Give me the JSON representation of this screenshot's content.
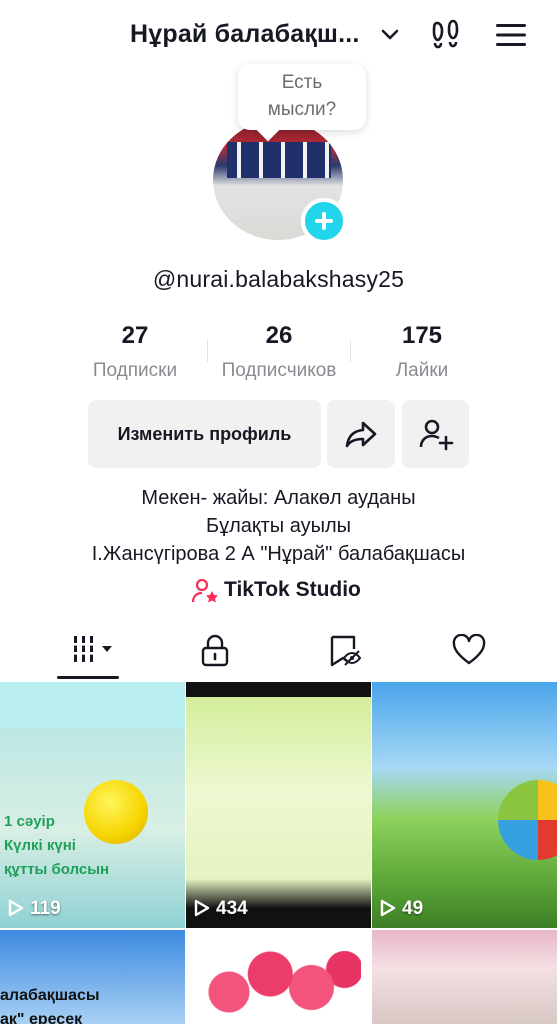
{
  "header": {
    "title": "Нұрай балабақш..."
  },
  "bubble": {
    "line1": "Есть",
    "line2": "мысли?"
  },
  "profile": {
    "username": "@nurai.balabakshasy25"
  },
  "stats": [
    {
      "value": "27",
      "label": "Подписки"
    },
    {
      "value": "26",
      "label": "Подписчиков"
    },
    {
      "value": "175",
      "label": "Лайки"
    }
  ],
  "actions": {
    "edit_label": "Изменить профиль"
  },
  "bio": {
    "line1": "Мекен- жайы: Алакөл ауданы",
    "line2": "Бұлақты ауылы",
    "line3": "І.Жансүгірова 2 А \"Нұрай\" балабақшасы"
  },
  "studio": {
    "label": "TikTok Studio"
  },
  "videos": [
    {
      "views": "119",
      "caption_line1": "1 сәуір",
      "caption_line2": "Күлкі күні",
      "caption_line3": "құтты болсын"
    },
    {
      "views": "434"
    },
    {
      "views": "49"
    },
    {
      "caption_line1": "алабақшасы",
      "caption_line2": "ак\" ересек"
    },
    {},
    {}
  ],
  "colors": {
    "accent": "#20d5ec",
    "studio_pink": "#fe2c55"
  }
}
